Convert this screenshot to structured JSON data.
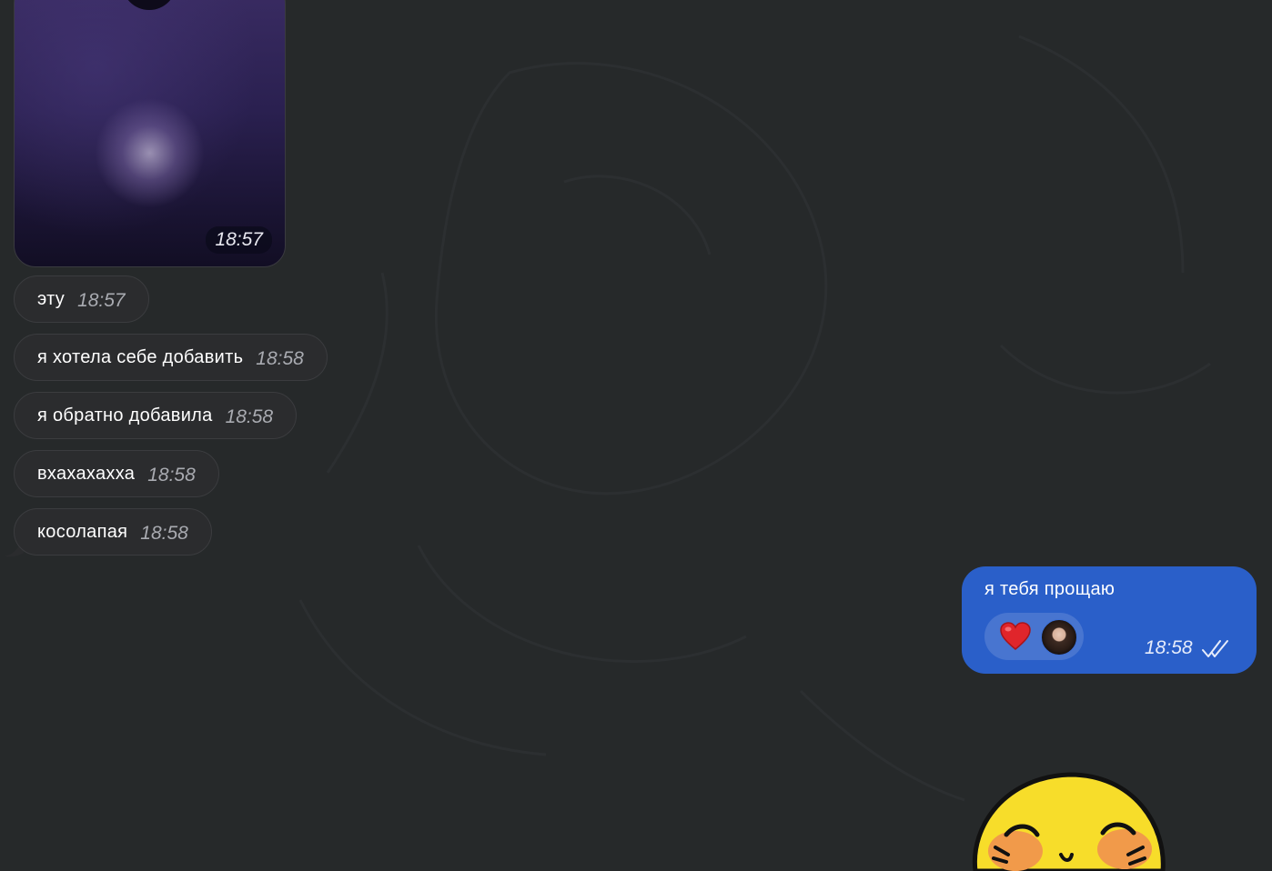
{
  "image_message": {
    "time": "18:57"
  },
  "incoming_messages": [
    {
      "text": "эту",
      "time": "18:57"
    },
    {
      "text": "я хотела себе добавить",
      "time": "18:58"
    },
    {
      "text": "я обратно добавила",
      "time": "18:58"
    },
    {
      "text": "вхахахахха",
      "time": "18:58"
    },
    {
      "text": "косолапая",
      "time": "18:58"
    }
  ],
  "outgoing_message": {
    "text": "я тебя прощаю",
    "time": "18:58",
    "reaction_icon": "heart-icon",
    "read_status_icon": "double-check-icon"
  },
  "colors": {
    "background": "#26292a",
    "incoming_bubble": "#2b2c2e",
    "outgoing_bubble": "#2a5fc9"
  }
}
